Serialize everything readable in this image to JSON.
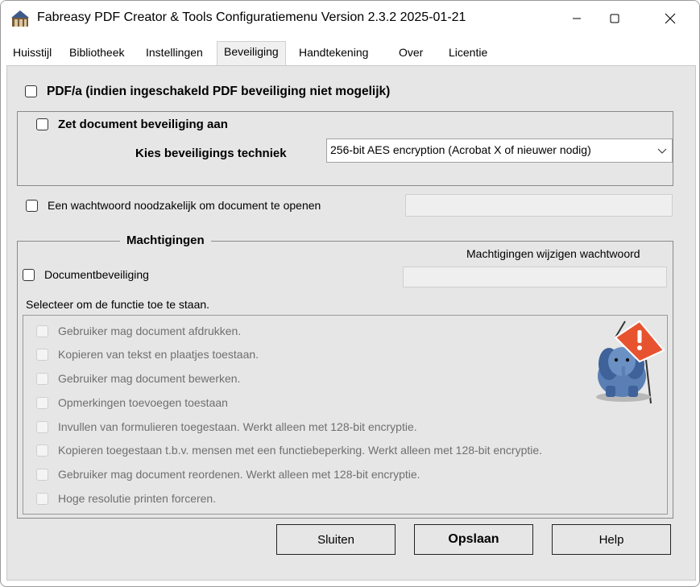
{
  "window": {
    "title": "Fabreasy PDF Creator & Tools  Configuratiemenu  Version 2.3.2  2025-01-21",
    "icon": "app-icon",
    "controls": [
      "minimize-icon",
      "maximize-icon",
      "close-icon"
    ]
  },
  "tabs": [
    {
      "label": "Huisstijl",
      "active": false
    },
    {
      "label": "Bibliotheek",
      "active": false
    },
    {
      "label": "Instellingen",
      "active": false
    },
    {
      "label": "Beveiliging",
      "active": true
    },
    {
      "label": "Handtekening",
      "active": false
    },
    {
      "label": "Over",
      "active": false
    },
    {
      "label": "Licentie",
      "active": false
    }
  ],
  "security": {
    "pdfa_label": "PDF/a (indien ingeschakeld PDF beveiliging niet mogelijk)",
    "pdfa_checked": false,
    "enable_label": "Zet document beveiliging aan",
    "enable_checked": false,
    "technique_label": "Kies beveiligings techniek",
    "technique_value": "256-bit AES encryption (Acrobat X of nieuwer nodig)",
    "open_password_label": "Een wachtwoord noodzakelijk om document te openen",
    "open_password_checked": false,
    "open_password_value": ""
  },
  "permissions": {
    "group_title": "Machtigingen",
    "change_password_label": "Machtigingen wijzigen wachtwoord",
    "change_password_value": "",
    "docsec_label": "Documentbeveiliging",
    "docsec_checked": false,
    "select_hint": "Selecteer om de functie toe te staan.",
    "items": [
      "Gebruiker mag document afdrukken.",
      "Kopieren van tekst en plaatjes toestaan.",
      "Gebruiker mag document bewerken.",
      "Opmerkingen toevoegen toestaan",
      "Invullen van formulieren toegestaan. Werkt alleen met 128-bit encryptie.",
      "Kopieren toegestaan t.b.v. mensen met een functiebeperking. Werkt alleen met 128-bit encryptie.",
      "Gebruiker mag document reordenen. Werkt alleen met 128-bit encryptie.",
      "Hoge resolutie printen forceren."
    ],
    "mascot": "elephant-warning-icon"
  },
  "buttons": {
    "close": "Sluiten",
    "save": "Opslaan",
    "help": "Help"
  },
  "colors": {
    "panel_bg": "#e6e6e6",
    "warning_red": "#e8532f",
    "elephant_blue": "#5a7fb5"
  }
}
